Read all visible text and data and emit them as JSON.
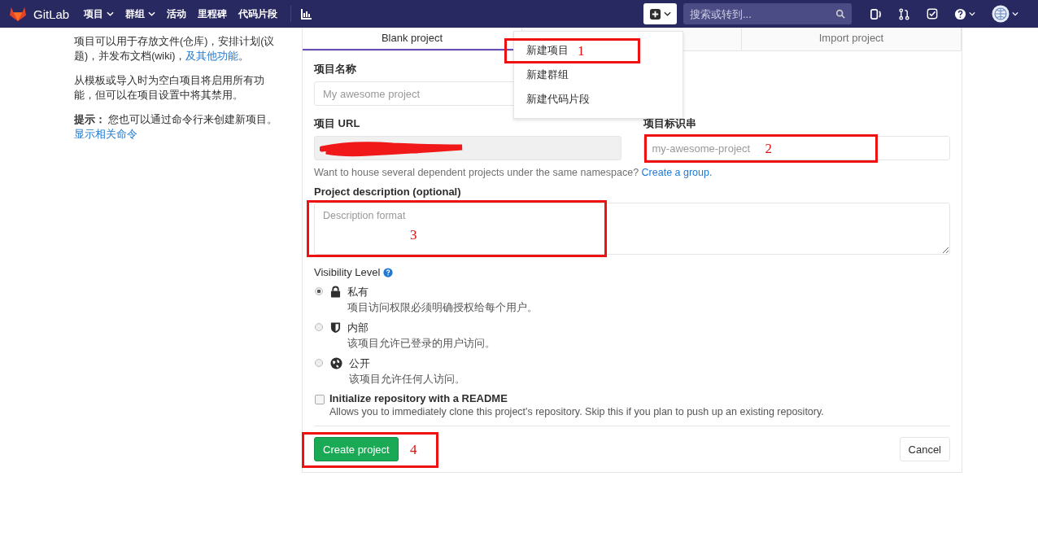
{
  "navbar": {
    "brand": "GitLab",
    "menu": [
      {
        "label": "项目",
        "dropdown": true
      },
      {
        "label": "群组",
        "dropdown": true
      },
      {
        "label": "活动",
        "dropdown": false
      },
      {
        "label": "里程碑",
        "dropdown": false
      },
      {
        "label": "代码片段",
        "dropdown": false
      }
    ],
    "search": {
      "placeholder": "搜索或转到..."
    }
  },
  "intro": [
    {
      "text": "项目可以用于存放文件(仓库)，安排计划(议题)，并发布文档(wiki)，",
      "link": "及其他功能",
      "after": "。"
    },
    {
      "text": "从模板或导入时为空白项目将启用所有功能，但可以在项目设置中将其禁用。"
    },
    {
      "text": "**提示：** 您也可以通过命令行来创建新项目。",
      "link": "显示相关命令"
    }
  ],
  "tabs": [
    {
      "label": "Blank project",
      "selected": true
    },
    {
      "selected": false
    },
    {
      "label": "Import project",
      "selected": false
    }
  ],
  "new_menu": [
    "新建项目",
    "新建群组",
    "新建代码片段"
  ],
  "form": {
    "name_label": "项目名称",
    "name_placeholder": "My awesome project",
    "url_label": "项目 URL",
    "slug_label": "项目标识串",
    "slug_placeholder": "my-awesome-project",
    "group_hint": "Want to house several dependent projects under the same namespace?",
    "group_link": "Create a group.",
    "description_label": "Project description (optional)",
    "description_placeholder": "Description format",
    "visibility_label": "Visibility Level",
    "visibility": [
      {
        "kind": "lock",
        "label": "私有",
        "hint": "项目访问权限必须明确授权给每个用户。",
        "selected": true
      },
      {
        "kind": "shield",
        "label": "内部",
        "hint": "该项目允许已登录的用户访问。",
        "selected": false
      },
      {
        "kind": "globe",
        "label": "公开",
        "hint": "该项目允许任何人访问。",
        "selected": false
      }
    ],
    "readme": {
      "label": "Initialize repository with a README",
      "hint": "Allows you to immediately clone this project's repository. Skip this if you plan to push up an existing repository.",
      "checked": false
    },
    "submit": "Create project",
    "cancel": "Cancel"
  },
  "annotations": [
    {
      "number": "1"
    },
    {
      "number": "2"
    },
    {
      "number": "3"
    },
    {
      "number": "4"
    }
  ]
}
